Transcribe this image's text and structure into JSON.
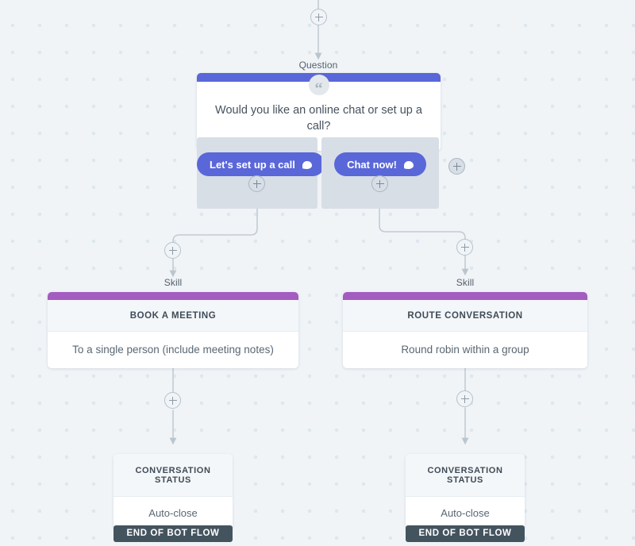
{
  "canvas": {
    "background_color": "#f0f4f7",
    "dot_color": "#dde7ee"
  },
  "colors": {
    "question_accent": "#5a67d8",
    "skill_accent": "#a35cc0",
    "option_panel": "#d7dee6",
    "end_button": "#44545f",
    "connector": "#c2ccd4"
  },
  "nodes": {
    "question": {
      "type_label": "Question",
      "quote_icon": "quote-icon",
      "text": "Would you like an online chat or set up a call?",
      "options": [
        {
          "label": "Let's set up a call",
          "icon": "chat-bubble-icon"
        },
        {
          "label": "Chat now!",
          "icon": "chat-bubble-icon"
        }
      ]
    },
    "skill_left": {
      "type_label": "Skill",
      "title": "BOOK A MEETING",
      "description": "To a single person (include meeting notes)"
    },
    "skill_right": {
      "type_label": "Skill",
      "title": "ROUTE CONVERSATION",
      "description": "Round robin within a group"
    },
    "status_left": {
      "title": "CONVERSATION STATUS",
      "value": "Auto-close",
      "end_label": "END OF BOT FLOW"
    },
    "status_right": {
      "title": "CONVERSATION STATUS",
      "value": "Auto-close",
      "end_label": "END OF BOT FLOW"
    }
  },
  "add_buttons": {
    "top": "add-step-icon",
    "option_left": "add-step-icon",
    "option_right": "add-step-icon",
    "option_extra": "add-option-icon",
    "branch_left": "add-step-icon",
    "branch_right": "add-step-icon",
    "after_skill_left": "add-step-icon",
    "after_skill_right": "add-step-icon"
  }
}
